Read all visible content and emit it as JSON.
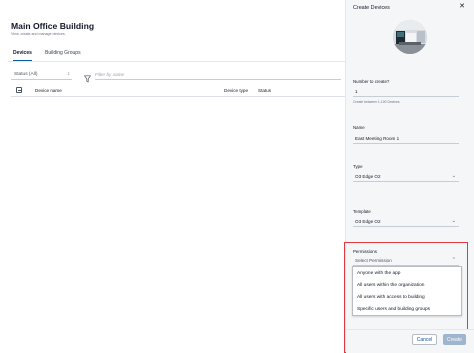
{
  "header": {
    "title": "Main Office Building",
    "subtitle": "View, create and manage devices."
  },
  "tabs": [
    {
      "label": "Devices",
      "active": true
    },
    {
      "label": "Building Groups",
      "active": false
    }
  ],
  "filters": {
    "status_value": "Status (All)",
    "filter_placeholder": "Filter by name"
  },
  "table": {
    "columns": [
      "Device name",
      "Device type",
      "Status"
    ],
    "rows": []
  },
  "drawer": {
    "title": "Create Devices",
    "number_label": "Number to create?",
    "number_value": "1",
    "number_help": "Create between 1-100 Devices",
    "name_label": "Name",
    "name_value": "East Meeting Room 1",
    "type_label": "Type",
    "type_value": "O3 Edge O2",
    "template_label": "Template",
    "template_value": "O3 Edge O2",
    "permissions_label": "Permissions",
    "permissions_placeholder": "Select Permission",
    "permission_options": [
      "Anyone with the app",
      "All users within the organization",
      "All users with access to building",
      "Specific users and building groups"
    ]
  },
  "footer": {
    "cancel_label": "Cancel",
    "create_label": "Create"
  },
  "colors": {
    "accent": "#0b5cab",
    "highlight": "#e0393e",
    "create_disabled": "#9fb4cf"
  }
}
